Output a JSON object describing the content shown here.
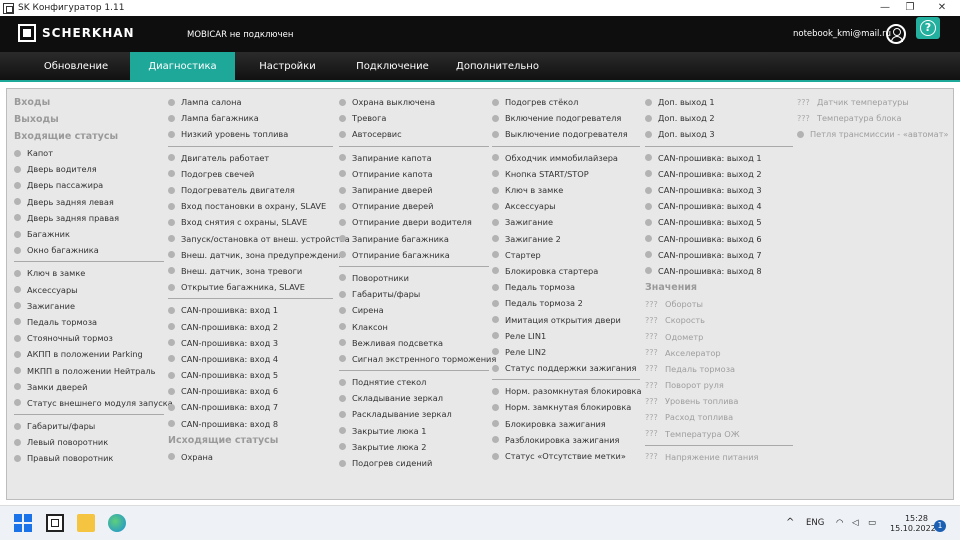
{
  "window": {
    "title": "SK Конфигуратор 1.11",
    "minimize": "—",
    "maximize": "❐",
    "close": "✕"
  },
  "header": {
    "brand": "SCHERKHAN",
    "status": "MOBICAR не подключен",
    "email": "notebook_kmi@mail.ru",
    "help": "?"
  },
  "nav": {
    "tabs": [
      "Обновление",
      "Диагностика",
      "Настройки",
      "Подключение",
      "Дополнительно"
    ],
    "active": 1
  },
  "col1": {
    "head_inputs": "Входы",
    "head_outputs": "Выходы",
    "head_status": "Входящие статусы",
    "g1": [
      "Капот",
      "Дверь водителя",
      "Дверь пассажира",
      "Дверь задняя левая",
      "Дверь задняя правая",
      "Багажник",
      "Окно багажника"
    ],
    "g2": [
      "Ключ в замке",
      "Аксессуары",
      "Зажигание",
      "Педаль тормоза",
      "Стояночный тормоз",
      "АКПП в положении Parking",
      "МКПП в положении Нейтраль",
      "Замки дверей",
      "Статус внешнего модуля запуска"
    ],
    "g3": [
      "Габариты/фары",
      "Левый поворотник",
      "Правый поворотник"
    ]
  },
  "col2": {
    "g1": [
      "Лампа салона",
      "Лампа багажника",
      "Низкий уровень топлива"
    ],
    "g2": [
      "Двигатель работает",
      "Подогрев свечей",
      "Подогреватель двигателя",
      "Вход постановки в охрану, SLAVE",
      "Вход снятия с охраны, SLAVE",
      "Запуск/остановка от внеш. устройства",
      "Внеш. датчик, зона предупреждения",
      "Внеш. датчик, зона тревоги",
      "Открытие багажника, SLAVE"
    ],
    "g3": [
      "CAN-прошивка: вход 1",
      "CAN-прошивка: вход 2",
      "CAN-прошивка: вход 3",
      "CAN-прошивка: вход 4",
      "CAN-прошивка: вход 5",
      "CAN-прошивка: вход 6",
      "CAN-прошивка: вход 7",
      "CAN-прошивка: вход 8"
    ],
    "head_out_status": "Исходящие статусы",
    "g4": [
      "Охрана"
    ]
  },
  "col3": {
    "g1": [
      "Охрана выключена",
      "Тревога",
      "Автосервис"
    ],
    "g2": [
      "Запирание капота",
      "Отпирание капота",
      "Запирание дверей",
      "Отпирание дверей",
      "Отпирание двери водителя",
      "Запирание багажника",
      "Отпирание багажника"
    ],
    "g3": [
      "Поворотники",
      "Габариты/фары",
      "Сирена",
      "Клаксон",
      "Вежливая подсветка",
      "Сигнал экстренного торможения"
    ],
    "g4": [
      "Поднятие стекол",
      "Складывание зеркал",
      "Раскладывание зеркал",
      "Закрытие люка 1",
      "Закрытие люка 2",
      "Подогрев сидений"
    ]
  },
  "col4": {
    "g1": [
      "Подогрев стёкол",
      "Включение подогревателя",
      "Выключение подогревателя"
    ],
    "g2": [
      "Обходчик иммобилайзера",
      "Кнопка START/STOP",
      "Ключ в замке",
      "Аксессуары",
      "Зажигание",
      "Зажигание 2",
      "Стартер",
      "Блокировка стартера",
      "Педаль тормоза",
      "Педаль тормоза 2",
      "Имитация открытия двери",
      "Реле LIN1",
      "Реле LIN2",
      "Статус поддержки зажигания"
    ],
    "g3": [
      "Норм. разомкнутая блокировка",
      "Норм. замкнутая блокировка",
      "Блокировка зажигания",
      "Разблокировка зажигания",
      "Статус «Отсутствие метки»"
    ]
  },
  "col5": {
    "g1": [
      "Доп. выход 1",
      "Доп. выход 2",
      "Доп. выход 3"
    ],
    "g2": [
      "CAN-прошивка: выход 1",
      "CAN-прошивка: выход 2",
      "CAN-прошивка: выход 3",
      "CAN-прошивка: выход 4",
      "CAN-прошивка: выход 5",
      "CAN-прошивка: выход 6",
      "CAN-прошивка: выход 7",
      "CAN-прошивка: выход 8"
    ],
    "head_values": "Значения",
    "unknown": "???",
    "values": [
      "Обороты",
      "Скорость",
      "Одометр",
      "Акселератор",
      "Педаль тормоза",
      "Поворот руля",
      "Уровень топлива",
      "Расход топлива",
      "Температура ОЖ"
    ],
    "voltage": "Напряжение питания"
  },
  "col6": {
    "items": [
      "Датчик температуры",
      "Температура блока"
    ],
    "loop": "Петля трансмиссии - «автомат»"
  },
  "taskbar": {
    "lang": "ENG",
    "time": "15:28",
    "date": "15.10.2022",
    "notifications": "1",
    "chevron": "^"
  }
}
